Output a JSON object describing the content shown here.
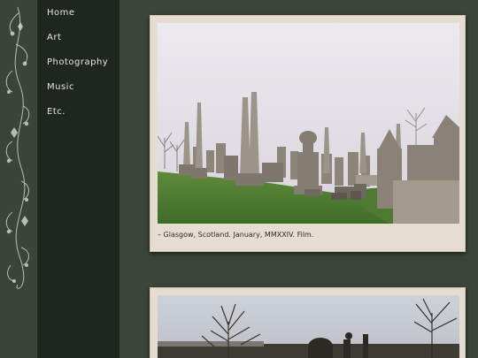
{
  "nav": {
    "items": [
      {
        "label": "Home"
      },
      {
        "label": "Art"
      },
      {
        "label": "Photography"
      },
      {
        "label": "Music"
      },
      {
        "label": "Etc."
      }
    ]
  },
  "posts": [
    {
      "caption": "– Glasgow, Scotland. January, MMXXIV. Film."
    },
    {
      "caption": ""
    }
  ],
  "colors": {
    "page_bg": "#3b4539",
    "sidebar_bg": "#1f2620",
    "card_bg": "#e6ddd2",
    "nav_text": "#e8e6dc"
  }
}
